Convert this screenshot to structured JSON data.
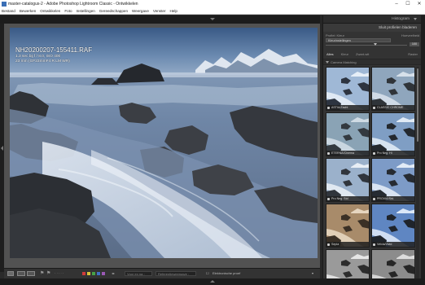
{
  "window": {
    "title": "master-catalogus-2 - Adobe Photoshop Lightroom Classic - Ontwikkelen",
    "minimize": "–",
    "maximize": "☐",
    "close": "✕"
  },
  "menu": [
    "Bestand",
    "Bewerken",
    "Ontwikkelen",
    "Foto",
    "Instellingen",
    "Gereedschappen",
    "Weergave",
    "Venster",
    "Help"
  ],
  "photo_overlay": {
    "filename": "NH20200207-155411.RAF",
    "line1": "1.3 sec bij f / 8.0, ISO 400",
    "line2": "23 mm (GF23mmF4 R LM WR)"
  },
  "right_panel": {
    "histogram_label": "Histogram",
    "profile_browser_title": "Sluit profielen bladeren",
    "profile_label": "Profiel: Kleur",
    "profile_value": "Kleurinstellingen",
    "amount_label": "Hoeveelheid",
    "amount_value": "100",
    "tabs": [
      {
        "label": "Alles",
        "selected": true
      },
      {
        "label": "Kleur",
        "selected": false
      },
      {
        "label": "Zwart-wit",
        "selected": false
      }
    ],
    "grid_label": "Raster",
    "group_label": "Camera Matching",
    "profiles": [
      {
        "name": "ASTIA/Zacht",
        "tone": "astia"
      },
      {
        "name": "CLASSIC CHROME",
        "tone": "classic"
      },
      {
        "name": "ETERNA/Cinema",
        "tone": "eterna"
      },
      {
        "name": "Pro Neg. Hi",
        "tone": "proneghi"
      },
      {
        "name": "Pro Neg. Std",
        "tone": "pronegstd"
      },
      {
        "name": "PROVIA/Std.",
        "tone": "provia"
      },
      {
        "name": "Sepia",
        "tone": "sepia"
      },
      {
        "name": "Velvia/Vivid",
        "tone": "velvia"
      },
      {
        "name": "",
        "tone": "mono1"
      },
      {
        "name": "",
        "tone": "mono2"
      }
    ]
  },
  "toolbar": {
    "labels": [
      "Voor en na :",
      "Referentieweergave :",
      "Elektronische proef"
    ],
    "color_labels": [
      "#d13b3b",
      "#d8c23a",
      "#47a247",
      "#3e6fc6",
      "#9b59b6"
    ]
  }
}
